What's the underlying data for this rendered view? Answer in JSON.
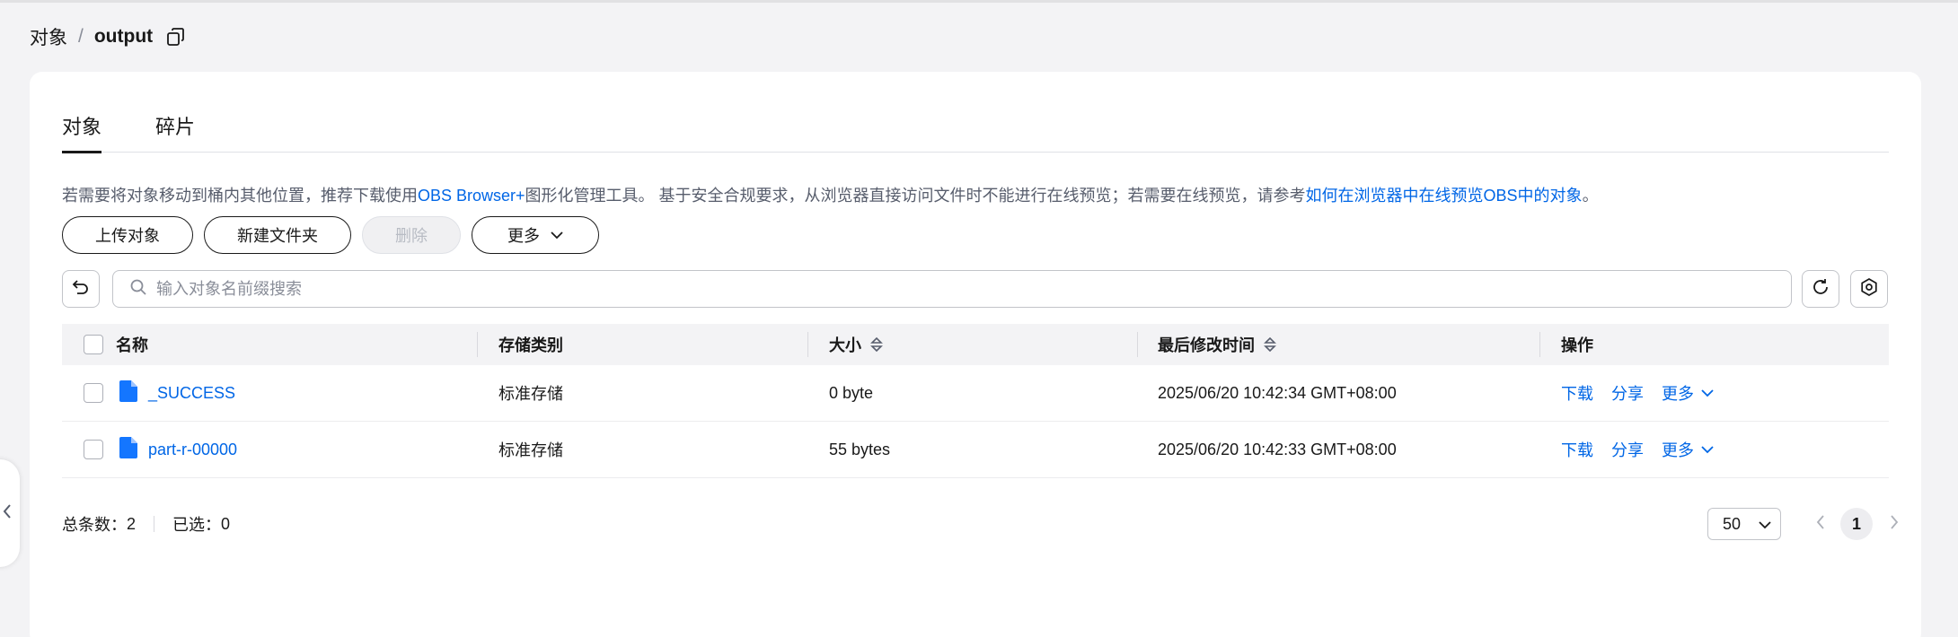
{
  "breadcrumb": {
    "root": "对象",
    "separator": "/",
    "current": "output"
  },
  "tabs": [
    {
      "label": "对象",
      "active": true
    },
    {
      "label": "碎片",
      "active": false
    }
  ],
  "notice": {
    "text_before_link1": "若需要将对象移动到桶内其他位置，推荐下载使用",
    "link1": "OBS Browser+",
    "text_after_link1": "图形化管理工具。 基于安全合规要求，从浏览器直接访问文件时不能进行在线预览；若需要在线预览，请参考",
    "link2": "如何在浏览器中在线预览OBS中的对象",
    "text_end": "。"
  },
  "toolbar": {
    "upload": "上传对象",
    "new_folder": "新建文件夹",
    "delete": "删除",
    "more": "更多"
  },
  "search": {
    "placeholder": "输入对象名前缀搜索",
    "value": ""
  },
  "table": {
    "columns": [
      "名称",
      "存储类别",
      "大小",
      "最后修改时间",
      "操作"
    ],
    "rows": [
      {
        "name": "_SUCCESS",
        "storage_class": "标准存储",
        "size": "0 byte",
        "modified": "2025/06/20 10:42:34 GMT+08:00",
        "actions": {
          "download": "下载",
          "share": "分享",
          "more": "更多"
        }
      },
      {
        "name": "part-r-00000",
        "storage_class": "标准存储",
        "size": "55 bytes",
        "modified": "2025/06/20 10:42:33 GMT+08:00",
        "actions": {
          "download": "下载",
          "share": "分享",
          "more": "更多"
        }
      }
    ]
  },
  "footer": {
    "total_label": "总条数：",
    "total_value": "2",
    "selected_label": "已选：",
    "selected_value": "0",
    "page_size": "50",
    "current_page": "1"
  },
  "colors": {
    "link": "#0066e6",
    "file_icon": "#1476ff",
    "page_bg": "#f3f3f5",
    "card_bg": "#ffffff"
  },
  "icons": {
    "copy": "copy-icon",
    "file": "file-icon",
    "search": "search-icon",
    "back": "undo-icon",
    "refresh": "refresh-icon",
    "settings": "gear-icon",
    "sort": "sort-icon",
    "chevron": "chevron-down-icon",
    "collapse": "chevron-left-icon"
  }
}
